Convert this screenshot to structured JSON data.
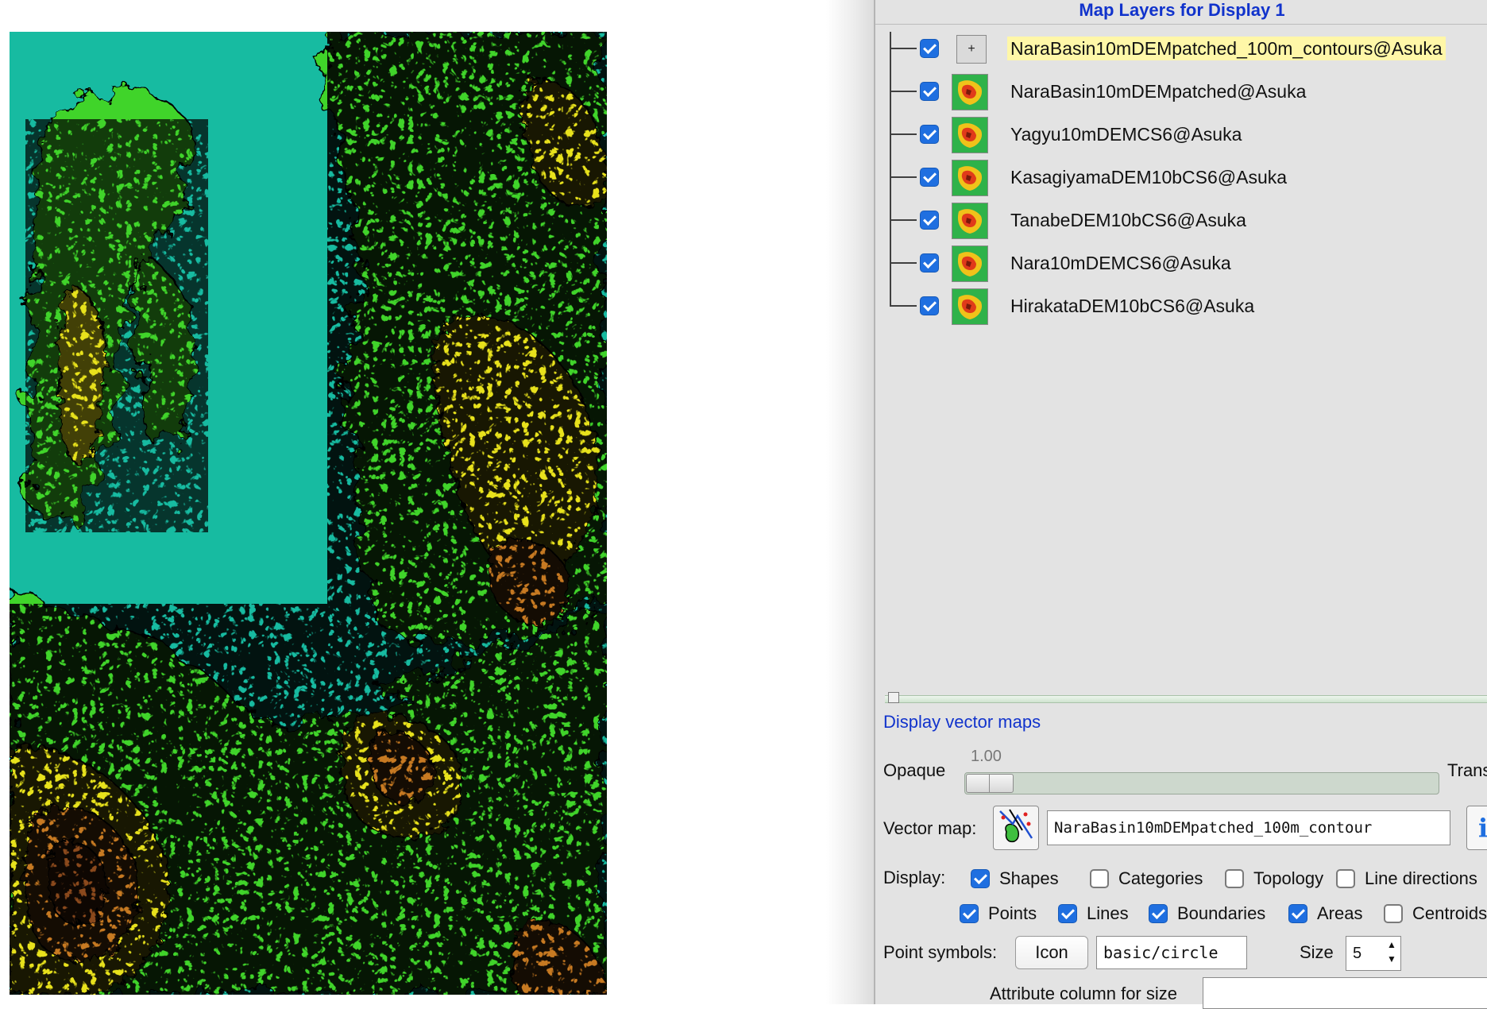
{
  "panel": {
    "title": "Map Layers for Display 1"
  },
  "layers": [
    {
      "name": "NaraBasin10mDEMpatched_100m_contours@Asuka",
      "checked": true,
      "type": "vector",
      "icon": "plus-icon",
      "selected": true
    },
    {
      "name": "NaraBasin10mDEMpatched@Asuka",
      "checked": true,
      "type": "raster",
      "icon": "raster-map-icon",
      "selected": false
    },
    {
      "name": "Yagyu10mDEMCS6@Asuka",
      "checked": true,
      "type": "raster",
      "icon": "raster-map-icon",
      "selected": false
    },
    {
      "name": "KasagiyamaDEM10bCS6@Asuka",
      "checked": true,
      "type": "raster",
      "icon": "raster-map-icon",
      "selected": false
    },
    {
      "name": "TanabeDEM10bCS6@Asuka",
      "checked": true,
      "type": "raster",
      "icon": "raster-map-icon",
      "selected": false
    },
    {
      "name": "Nara10mDEMCS6@Asuka",
      "checked": true,
      "type": "raster",
      "icon": "raster-map-icon",
      "selected": false
    },
    {
      "name": "HirakataDEM10bCS6@Asuka",
      "checked": true,
      "type": "raster",
      "icon": "raster-map-icon",
      "selected": false
    }
  ],
  "options": {
    "section_title": "Display vector maps",
    "opacity": {
      "left_label": "Opaque",
      "right_label": "Trans",
      "value_text": "1.00",
      "value": 1.0
    },
    "vector_map": {
      "label": "Vector map:",
      "value": "NaraBasin10mDEMpatched_100m_contour",
      "info_label": "i"
    },
    "display": {
      "label": "Display:",
      "row1": [
        {
          "label": "Shapes",
          "checked": true
        },
        {
          "label": "Categories",
          "checked": false
        },
        {
          "label": "Topology",
          "checked": false
        },
        {
          "label": "Line directions",
          "checked": false
        }
      ],
      "row2": [
        {
          "label": "Points",
          "checked": true
        },
        {
          "label": "Lines",
          "checked": true
        },
        {
          "label": "Boundaries",
          "checked": true
        },
        {
          "label": "Areas",
          "checked": true
        },
        {
          "label": "Centroids",
          "checked": false
        }
      ]
    },
    "point_symbols": {
      "label": "Point symbols:",
      "icon_button": "Icon",
      "symbol": "basic/circle",
      "size_label": "Size",
      "size": "5"
    },
    "attribute_size": {
      "label": "Attribute column for size"
    }
  },
  "colors": {
    "accent": "#1133cc",
    "checkbox": "#1f6fe0",
    "selected_row": "#fff7a8",
    "panel_bg": "#e3e3e3",
    "map_low": "#17bba1",
    "map_mid": "#3fd42a",
    "map_high": "#e8e21a",
    "map_peak": "#a0561c",
    "contour": "#000000"
  }
}
